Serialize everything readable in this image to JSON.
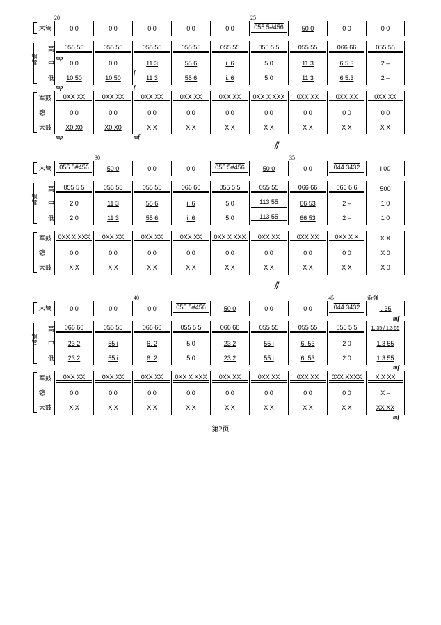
{
  "page_label": "第2页",
  "sep": "//",
  "labels": {
    "mu": "木管",
    "gao": "高",
    "zhong": "中",
    "di": "低",
    "tong": "铜管",
    "jun": "军鼓",
    "bo": "镲",
    "dagu": "大鼓",
    "jianqiang": "渐强"
  },
  "dyn": {
    "mp": "mp",
    "f": "f",
    "mf": "mf"
  },
  "barnums": {
    "b20": "20",
    "b25": "25",
    "b30": "30",
    "b35": "35",
    "b40": "40",
    "b45": "45"
  },
  "s1": {
    "mu": [
      "0  0",
      "0  0",
      "0  0",
      "0  0",
      "0  0",
      "055 5#456",
      "50  0",
      "0  0",
      "0  0"
    ],
    "gao": [
      "055 55",
      "055 55",
      "055 55",
      "055 55",
      "055 55",
      "055 5  5",
      "055 55",
      "066 66",
      "055 55"
    ],
    "zh": [
      "0  0",
      "0  0",
      "11  3",
      "55  6",
      "i.  6",
      "5  0",
      "11  3",
      "6  5.3",
      "2  –"
    ],
    "dii": [
      "10  50",
      "10  50",
      "11  3",
      "55  6",
      "i.  6",
      "5  0",
      "11  3",
      "6  5.3",
      "2  –"
    ],
    "jg": [
      "0XX XX",
      "0XX XX",
      "0XX XX",
      "0XX XX",
      "0XX XX",
      "0XX X XXX",
      "0XX XX",
      "0XX XX",
      "0XX XX"
    ],
    "bo": [
      "0  0",
      "0  0",
      "0  0",
      "0  0",
      "0  0",
      "0  0",
      "0  0",
      "0  0",
      "0  0"
    ],
    "dg": [
      "X0  X0",
      "X0  X0",
      "X  X",
      "X  X",
      "X  X",
      "X  X",
      "X  X",
      "X  X",
      "X  X"
    ]
  },
  "s2": {
    "mu": [
      "055 5#456",
      "50  0",
      "0  0",
      "0  0",
      "055 5#456",
      "50  0",
      "0  0",
      "044 3432",
      "i 00"
    ],
    "gao": [
      "055 5  5",
      "055 55",
      "055 55",
      "066 66",
      "055 5  5",
      "055 55",
      "066 66",
      "066 6  6",
      "500"
    ],
    "zh": [
      "2  0",
      "11  3",
      "55  6",
      "i.  6",
      "5  0",
      "113 55",
      "66  53",
      "2  –",
      "1  0"
    ],
    "dii": [
      "2  0",
      "11  3",
      "55  6",
      "i.  6",
      "5  0",
      "113 55",
      "66  53",
      "2  –",
      "1  0"
    ],
    "jg": [
      "0XX X XXX",
      "0XX XX",
      "0XX XX",
      "0XX XX",
      "0XX X XXX",
      "0XX XX",
      "0XX XX",
      "0XX X  X",
      "X  X"
    ],
    "bo": [
      "0  0",
      "0  0",
      "0  0",
      "0  0",
      "0  0",
      "0  0",
      "0  0",
      "0  0",
      "X  0"
    ],
    "dg": [
      "X  X",
      "X  X",
      "X  X",
      "X  X",
      "X  X",
      "X  X",
      "X  X",
      "X  X",
      "X  0"
    ]
  },
  "s3": {
    "mu": [
      "0  0",
      "0  0",
      "0  0",
      "055 5#456",
      "50  0",
      "0  0",
      "0  0",
      "044 3432",
      "i.  35"
    ],
    "gao": [
      "066 66",
      "055 55",
      "066 66",
      "055 5  5",
      "066 66",
      "055 55",
      "055 55",
      "055 5 5",
      "1. 35 / 1.3 55"
    ],
    "zh": [
      "23  2",
      "55  i",
      "6.  2",
      "5  0",
      "23  2",
      "55  i",
      "6.  53",
      "2  0",
      "1.3 55"
    ],
    "dii": [
      "23  2",
      "55  i",
      "6.  2",
      "5  0",
      "23  2",
      "55  i",
      "6.  53",
      "2  0",
      "1.3 55"
    ],
    "jg": [
      "0XX XX",
      "0XX XX",
      "0XX XX",
      "0XX X XXX",
      "0XX XX",
      "0XX XX",
      "0XX XX",
      "0XX XXXX",
      "X.X XX"
    ],
    "bo": [
      "0  0",
      "0  0",
      "0  0",
      "0  0",
      "0  0",
      "0  0",
      "0  0",
      "0  0",
      "X  –"
    ],
    "dg": [
      "X  X",
      "X  X",
      "X  X",
      "X  X",
      "X  X",
      "X  X",
      "X  X",
      "X  X",
      "XX  XX"
    ]
  }
}
